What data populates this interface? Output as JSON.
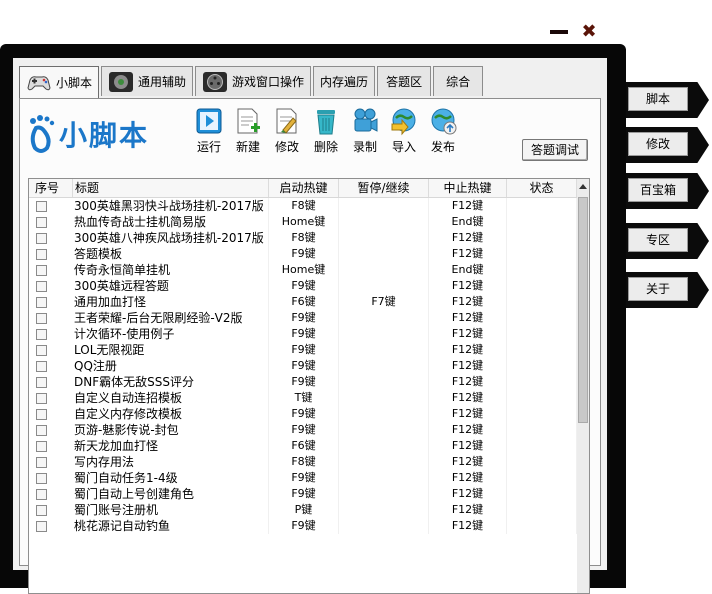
{
  "window": {
    "minimize_icon": "minimize-icon",
    "close_icon": "close-icon",
    "close_glyph": "✖"
  },
  "side_buttons": [
    "脚本",
    "修改",
    "百宝箱",
    "专区",
    "关于"
  ],
  "tabs": [
    {
      "label": "小脚本",
      "icon": "gamepad-icon",
      "active": true
    },
    {
      "label": "通用辅助",
      "icon": "gear-circle-icon"
    },
    {
      "label": "游戏窗口操作",
      "icon": "film-reel-icon"
    },
    {
      "label": "内存遍历"
    },
    {
      "label": "答题区"
    },
    {
      "label": "综合"
    }
  ],
  "logo_text": "小脚本",
  "toolbar": [
    {
      "label": "运行",
      "icon": "run-icon"
    },
    {
      "label": "新建",
      "icon": "new-doc-icon"
    },
    {
      "label": "修改",
      "icon": "edit-doc-icon"
    },
    {
      "label": "删除",
      "icon": "trash-icon"
    },
    {
      "label": "录制",
      "icon": "camera-icon"
    },
    {
      "label": "导入",
      "icon": "import-globe-icon"
    },
    {
      "label": "发布",
      "icon": "publish-globe-icon"
    }
  ],
  "debug_button": "答题调试",
  "table": {
    "columns": [
      "序号",
      "标题",
      "启动热键",
      "暂停/继续",
      "中止热键",
      "状态"
    ],
    "rows": [
      {
        "title": "300英雄黑羽快斗战场挂机-2017版",
        "start": "F8键",
        "pause": "",
        "stop": "F12键"
      },
      {
        "title": "热血传奇战士挂机简易版",
        "start": "Home键",
        "pause": "",
        "stop": "End键"
      },
      {
        "title": "300英雄八神疾风战场挂机-2017版",
        "start": "F8键",
        "pause": "",
        "stop": "F12键"
      },
      {
        "title": "答题模板",
        "start": "F9键",
        "pause": "",
        "stop": "F12键"
      },
      {
        "title": "传奇永恒简单挂机",
        "start": "Home键",
        "pause": "",
        "stop": "End键"
      },
      {
        "title": "300英雄远程答题",
        "start": "F9键",
        "pause": "",
        "stop": "F12键"
      },
      {
        "title": "通用加血打怪",
        "start": "F6键",
        "pause": "F7键",
        "stop": "F12键"
      },
      {
        "title": "王者荣耀-后台无限刷经验-V2版",
        "start": "F9键",
        "pause": "",
        "stop": "F12键"
      },
      {
        "title": "计次循环-使用例子",
        "start": "F9键",
        "pause": "",
        "stop": "F12键"
      },
      {
        "title": "LOL无限视距",
        "start": "F9键",
        "pause": "",
        "stop": "F12键"
      },
      {
        "title": "QQ注册",
        "start": "F9键",
        "pause": "",
        "stop": "F12键"
      },
      {
        "title": "DNF霸体无敌SSS评分",
        "start": "F9键",
        "pause": "",
        "stop": "F12键"
      },
      {
        "title": "自定义自动连招模板",
        "start": "T键",
        "pause": "",
        "stop": "F12键"
      },
      {
        "title": "自定义内存修改模板",
        "start": "F9键",
        "pause": "",
        "stop": "F12键"
      },
      {
        "title": "页游-魅影传说-封包",
        "start": "F9键",
        "pause": "",
        "stop": "F12键"
      },
      {
        "title": "新天龙加血打怪",
        "start": "F6键",
        "pause": "",
        "stop": "F12键"
      },
      {
        "title": "写内存用法",
        "start": "F8键",
        "pause": "",
        "stop": "F12键"
      },
      {
        "title": "蜀门自动任务1-4级",
        "start": "F9键",
        "pause": "",
        "stop": "F12键"
      },
      {
        "title": "蜀门自动上号创建角色",
        "start": "F9键",
        "pause": "",
        "stop": "F12键"
      },
      {
        "title": "蜀门账号注册机",
        "start": "P键",
        "pause": "",
        "stop": "F12键"
      },
      {
        "title": "桃花源记自动钓鱼",
        "start": "F9键",
        "pause": "",
        "stop": "F12键"
      }
    ]
  },
  "colors": {
    "accent_blue": "#1b77c9",
    "frame": "#070707"
  }
}
